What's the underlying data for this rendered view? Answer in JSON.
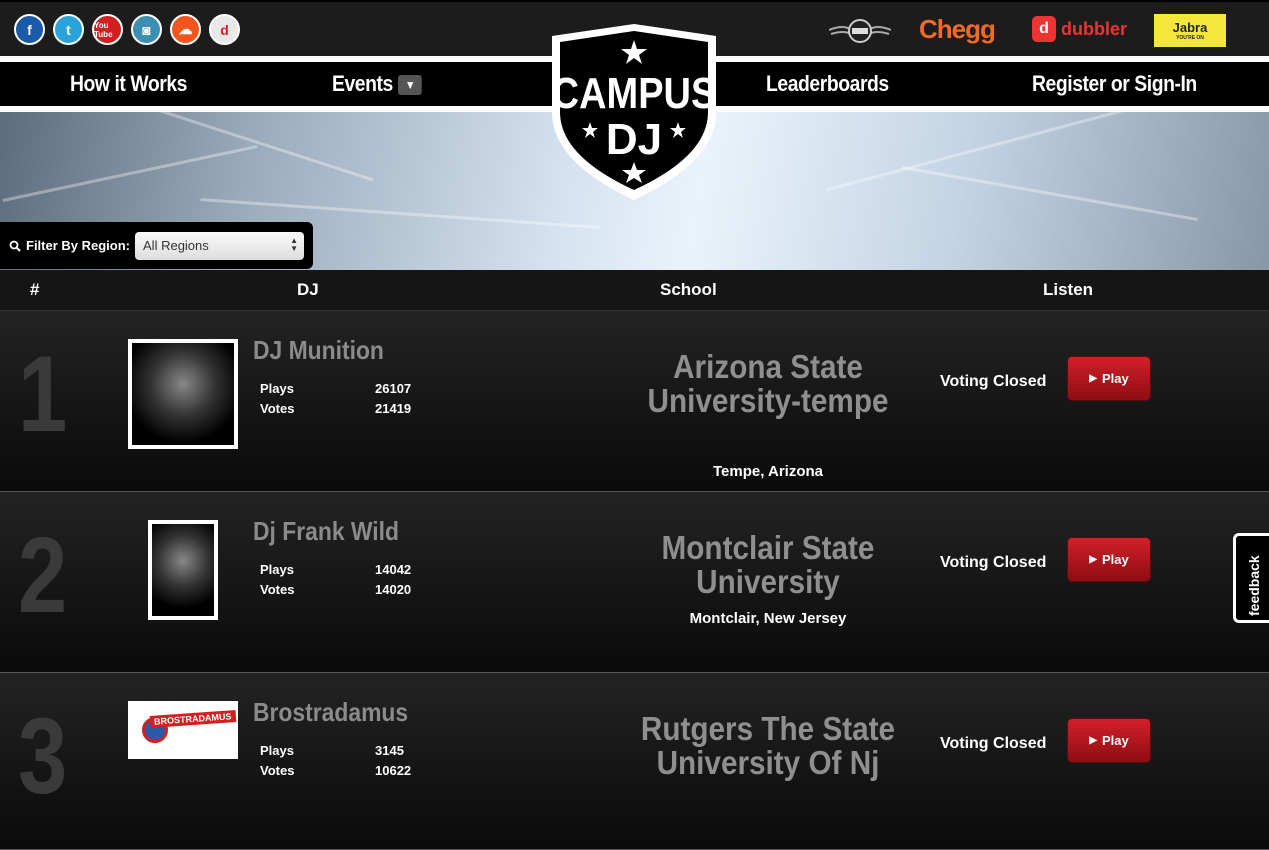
{
  "social": {
    "icons": [
      {
        "name": "facebook-icon",
        "glyph": "f"
      },
      {
        "name": "twitter-icon",
        "glyph": "t"
      },
      {
        "name": "youtube-icon",
        "glyph": "You Tube"
      },
      {
        "name": "instagram-icon",
        "glyph": "◙"
      },
      {
        "name": "soundcloud-icon",
        "glyph": "☁"
      },
      {
        "name": "dubbler-icon",
        "glyph": "d"
      }
    ]
  },
  "sponsors": {
    "chegg": "Chegg",
    "dubbler": "dubbler",
    "dubbler_glyph": "d",
    "jabra": "Jabra",
    "jabra_tag": "YOU'RE ON"
  },
  "nav": {
    "how": "How it Works",
    "events": "Events",
    "leaderboards": "Leaderboards",
    "register": "Register or Sign-In"
  },
  "logo": {
    "line1": "CAMPUS",
    "line2": "DJ"
  },
  "filter": {
    "label": "Filter By Region:",
    "selected": "All Regions"
  },
  "table": {
    "headers": {
      "rank": "#",
      "dj": "DJ",
      "school": "School",
      "listen": "Listen"
    },
    "plays_label": "Plays",
    "votes_label": "Votes",
    "voting_label": "Voting Closed",
    "play_label": "Play",
    "rows": [
      {
        "rank": "1",
        "dj": "DJ Munition",
        "plays": "26107",
        "votes": "21419",
        "school": "Arizona State University-tempe",
        "location": "Tempe, Arizona"
      },
      {
        "rank": "2",
        "dj": "Dj Frank Wild",
        "plays": "14042",
        "votes": "14020",
        "school": "Montclair State University",
        "location": "Montclair, New Jersey"
      },
      {
        "rank": "3",
        "dj": "Brostradamus",
        "plays": "3145",
        "votes": "10622",
        "school": "Rutgers The State University Of Nj",
        "location": ""
      }
    ]
  },
  "brostradamus_logo": "BROSTRADAMUS",
  "feedback": "feedback",
  "colors": {
    "accent": "#d2202a",
    "background": "#111111"
  }
}
